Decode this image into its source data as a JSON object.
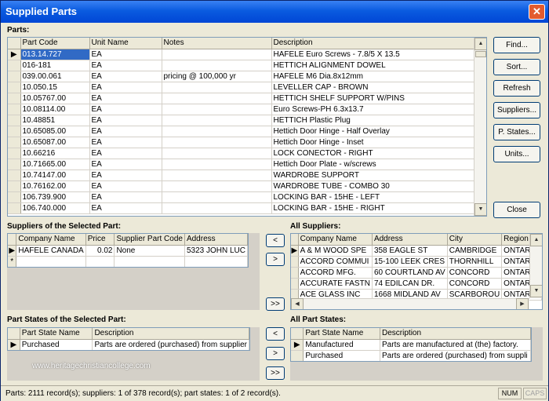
{
  "window": {
    "title": "Supplied Parts",
    "close_symbol": "✕"
  },
  "parts": {
    "label": "Parts:",
    "columns": [
      "Part Code",
      "Unit Name",
      "Notes",
      "Description"
    ],
    "rows": [
      [
        "013.14.727",
        "EA",
        "",
        "HAFELE Euro Screws - 7.8/5 X 13.5"
      ],
      [
        "016-181",
        "EA",
        "",
        "HETTICH ALIGNMENT DOWEL"
      ],
      [
        "039.00.061",
        "EA",
        "pricing @ 100,000 yr",
        "HAFELE M6 Dia.8x12mm"
      ],
      [
        "10.050.15",
        "EA",
        "",
        "LEVELLER CAP - BROWN"
      ],
      [
        "10.05767.00",
        "EA",
        "",
        "HETTICH SHELF SUPPORT W/PINS"
      ],
      [
        "10.08114.00",
        "EA",
        "",
        "Euro Screws-PH 6.3x13.7"
      ],
      [
        "10.48851",
        "EA",
        "",
        "HETTICH Plastic Plug"
      ],
      [
        "10.65085.00",
        "EA",
        "",
        "Hettich Door Hinge - Half Overlay"
      ],
      [
        "10.65087.00",
        "EA",
        "",
        "Hettich Door Hinge - Inset"
      ],
      [
        "10.66216",
        "EA",
        "",
        "LOCK CONECTOR - RIGHT"
      ],
      [
        "10.71665.00",
        "EA",
        "",
        "Hettich Door Plate - w/screws"
      ],
      [
        "10.74147.00",
        "EA",
        "",
        "WARDROBE SUPPORT"
      ],
      [
        "10.76162.00",
        "EA",
        "",
        "WARDROBE TUBE - COMBO 30"
      ],
      [
        "106.739.900",
        "EA",
        "",
        "LOCKING BAR - 15HE - LEFT"
      ],
      [
        "106.740.000",
        "EA",
        "",
        "LOCKING BAR - 15HE - RIGHT"
      ]
    ]
  },
  "buttons": {
    "find": "Find...",
    "sort": "Sort...",
    "refresh": "Refresh",
    "suppliers": "Suppliers...",
    "pstates": "P. States...",
    "units": "Units...",
    "close": "Close"
  },
  "suppliers_selected": {
    "label": "Suppliers of the Selected Part:",
    "columns": [
      "Company Name",
      "Price",
      "Supplier Part Code",
      "Address"
    ],
    "rows": [
      [
        "HAFELE CANADA",
        "0.02",
        "None",
        "5323 JOHN LUC"
      ]
    ],
    "new_row_marker": "*"
  },
  "all_suppliers": {
    "label": "All Suppliers:",
    "columns": [
      "Company Name",
      "Address",
      "City",
      "Region"
    ],
    "rows": [
      [
        "A & M WOOD SPE",
        "358 EAGLE ST",
        "CAMBRIDGE",
        "ONTARIO"
      ],
      [
        "ACCORD COMMUI",
        "15-100 LEEK CRES",
        "THORNHILL",
        "ONTARIO"
      ],
      [
        "ACCORD MFG.",
        "60 COURTLAND AV",
        "CONCORD",
        "ONTARIO"
      ],
      [
        "ACCURATE FASTN",
        "74 EDILCAN DR.",
        "CONCORD",
        "ONTARIO"
      ],
      [
        "ACE GLASS INC",
        "1668 MIDLAND AV",
        "SCARBOROU",
        "ONTARIO"
      ]
    ]
  },
  "transfer": {
    "add_one": "<",
    "remove_one": ">",
    "remove_all": ">>"
  },
  "part_states_selected": {
    "label": "Part States of the Selected Part:",
    "columns": [
      "Part State Name",
      "Description"
    ],
    "rows": [
      [
        "Purchased",
        "Parts are ordered (purchased) from supplier"
      ]
    ]
  },
  "all_part_states": {
    "label": "All Part States:",
    "columns": [
      "Part State Name",
      "Description"
    ],
    "rows": [
      [
        "Manufactured",
        "Parts are manufactured at (the) factory."
      ],
      [
        "Purchased",
        "Parts are ordered (purchased) from suppli"
      ]
    ]
  },
  "status": {
    "text": "Parts: 2111 record(s); suppliers: 1 of 378 record(s); part states: 1 of 2 record(s).",
    "num": "NUM",
    "caps": "CAPS"
  },
  "watermark": "www.heritagechristiancollege.com"
}
